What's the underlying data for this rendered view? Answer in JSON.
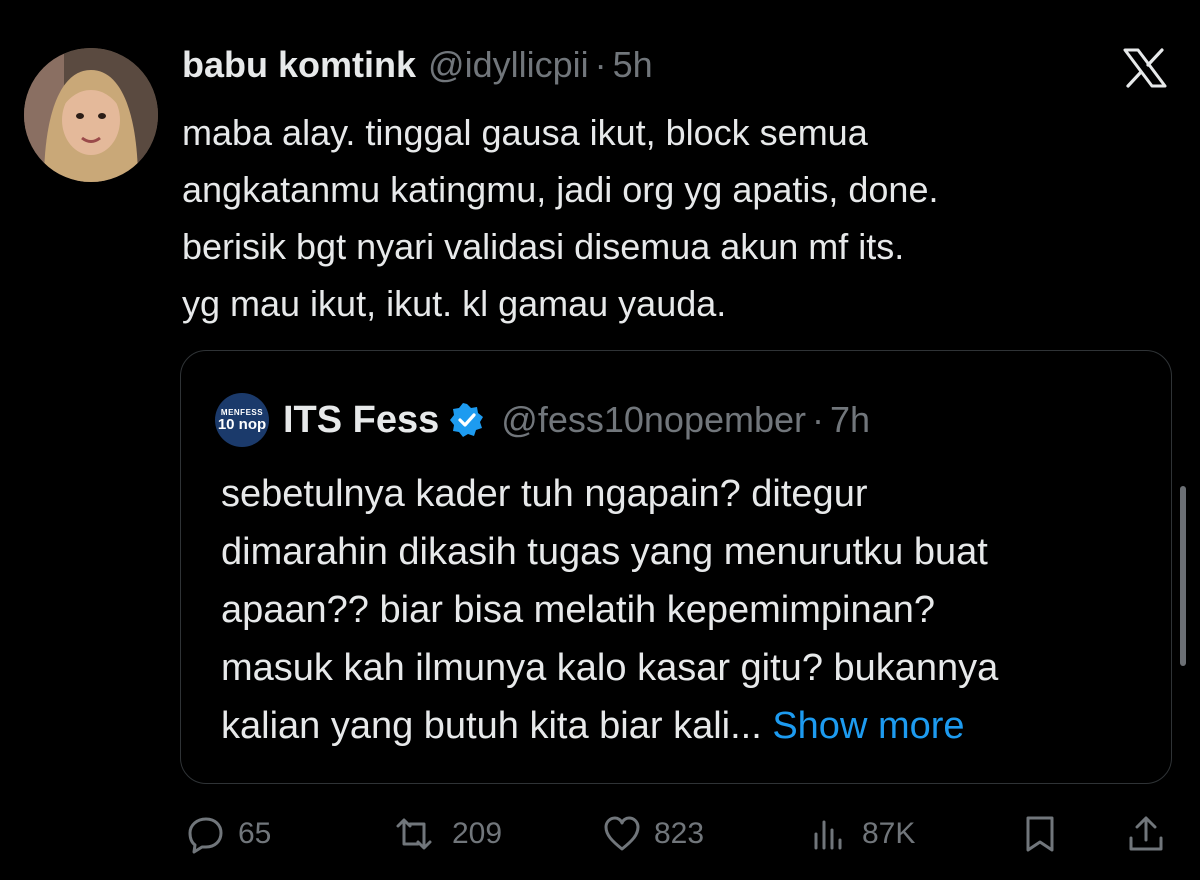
{
  "tweet": {
    "author_name": "babu komtink",
    "handle": "@idyllicpii",
    "separator": "·",
    "time": "5h",
    "text_lines": [
      "maba alay. tinggal gausa ikut, block semua",
      "angkatanmu katingmu, jadi org yg apatis, done.",
      "berisik bgt nyari validasi disemua akun mf its.",
      "yg mau ikut, ikut. kl gamau yauda."
    ]
  },
  "quote": {
    "avatar_text_top": "MENFESS",
    "avatar_text_bottom": "10 nop",
    "author_name": "ITS Fess",
    "handle": "@fess10nopember",
    "separator": "·",
    "time": "7h",
    "text_lines": [
      "sebetulnya kader tuh ngapain? ditegur",
      "dimarahin dikasih tugas yang menurutku buat",
      "apaan?? biar bisa melatih kepemimpinan?",
      "masuk kah ilmunya kalo kasar gitu? bukannya"
    ],
    "last_line": "kalian yang butuh kita biar kali...",
    "show_more": "Show more"
  },
  "actions": {
    "replies": "65",
    "reposts": "209",
    "likes": "823",
    "views": "87K"
  },
  "colors": {
    "background": "#000000",
    "text": "#e7e9ea",
    "muted": "#71767b",
    "link": "#1d9bf0",
    "border": "#2f3336"
  }
}
